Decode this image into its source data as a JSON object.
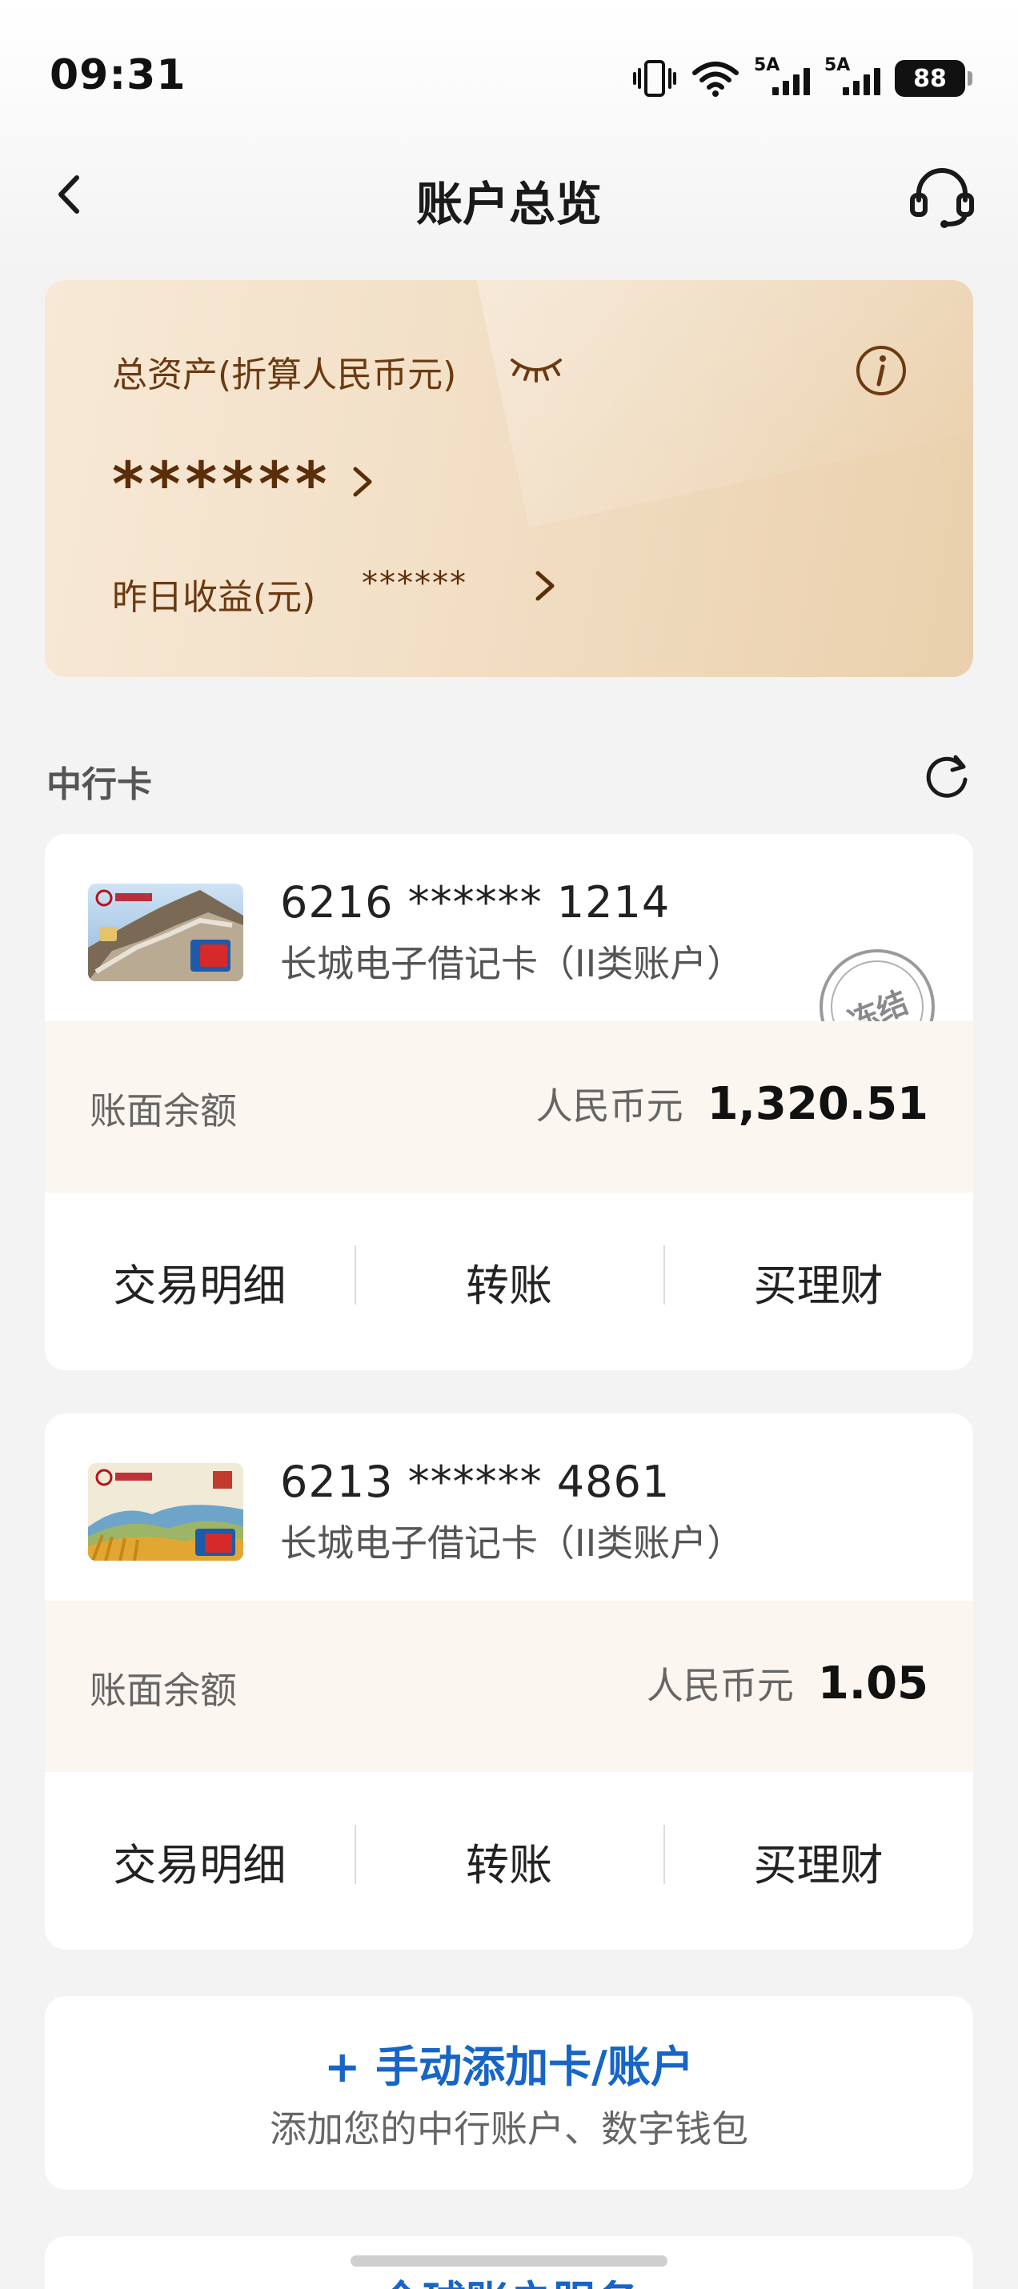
{
  "status_bar": {
    "time": "09:31",
    "signal1_label": "5A",
    "signal2_label": "5A",
    "battery": "88",
    "icons": [
      "vibrate-icon",
      "wifi-icon",
      "signal-icon",
      "signal-icon",
      "battery-icon"
    ]
  },
  "header": {
    "title": "账户总览",
    "back_icon": "chevron-left-icon",
    "support_icon": "headset-icon"
  },
  "assets": {
    "total_label": "总资产(折算人民币元)",
    "total_value": "******",
    "yesterday_label": "昨日收益(元)",
    "yesterday_value": "******",
    "colors": {
      "text": "#6b3a12",
      "bg_start": "#f7e9d6",
      "bg_end": "#ead0ac"
    }
  },
  "section": {
    "title": "中行卡"
  },
  "accounts": [
    {
      "number": "6216 ****** 1214",
      "type": "长城电子借记卡（II类账户）",
      "status_stamp": "冻结",
      "balance_label": "账面余额",
      "currency": "人民币元",
      "amount": "1,320.51",
      "actions": [
        "交易明细",
        "转账",
        "买理财"
      ]
    },
    {
      "number": "6213 ****** 4861",
      "type": "长城电子借记卡（II类账户）",
      "balance_label": "账面余额",
      "currency": "人民币元",
      "amount": "1.05",
      "actions": [
        "交易明细",
        "转账",
        "买理财"
      ]
    }
  ],
  "add_account": {
    "title": "+ 手动添加卡/账户",
    "subtitle": "添加您的中行账户、数字钱包",
    "color": "#1765c7"
  },
  "bottom_partial": {
    "title": "全球账户服务"
  }
}
